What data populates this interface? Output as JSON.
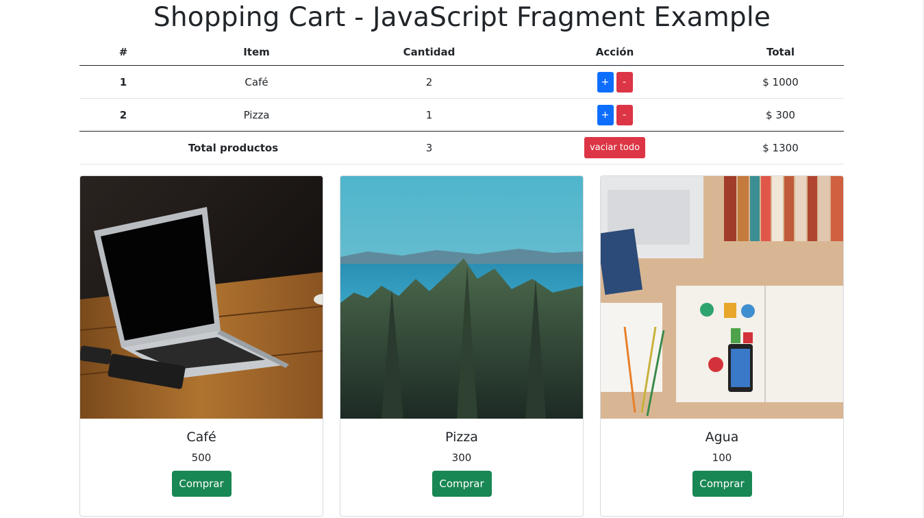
{
  "page_title": "Shopping Cart - JavaScript Fragment Example",
  "cart": {
    "headers": [
      "#",
      "Item",
      "Cantidad",
      "Acción",
      "Total"
    ],
    "rows": [
      {
        "num": "1",
        "item": "Café",
        "qty": "2",
        "plus": "+",
        "minus": "-",
        "total": "$ 1000"
      },
      {
        "num": "2",
        "item": "Pizza",
        "qty": "1",
        "plus": "+",
        "minus": "-",
        "total": "$ 300"
      }
    ],
    "footer": {
      "label": "Total productos",
      "qty": "3",
      "empty_label": "vaciar todo",
      "total": "$ 1300"
    }
  },
  "products": [
    {
      "name": "Café",
      "price": "500",
      "button": "Comprar",
      "image": "laptop-on-wooden-desk"
    },
    {
      "name": "Pizza",
      "price": "300",
      "button": "Comprar",
      "image": "forest-and-sea-landscape"
    },
    {
      "name": "Agua",
      "price": "100",
      "button": "Comprar",
      "image": "desk-with-books-and-magazine"
    }
  ],
  "colors": {
    "primary": "#0d6efd",
    "danger": "#dc3545",
    "success": "#198754"
  }
}
